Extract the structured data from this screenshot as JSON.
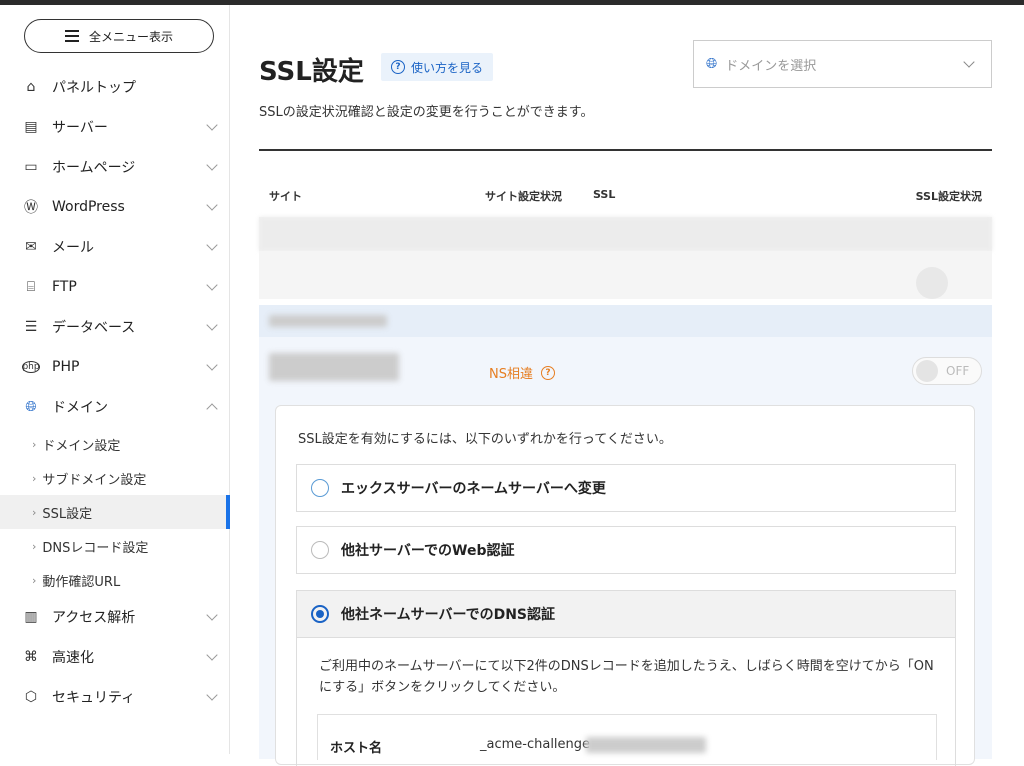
{
  "sidebar": {
    "menu_button": "全メニュー表示",
    "items": [
      {
        "label": "パネルトップ",
        "icon": "home-icon"
      },
      {
        "label": "サーバー",
        "icon": "server-icon"
      },
      {
        "label": "ホームページ",
        "icon": "window-icon"
      },
      {
        "label": "WordPress",
        "icon": "wordpress-icon"
      },
      {
        "label": "メール",
        "icon": "mail-icon"
      },
      {
        "label": "FTP",
        "icon": "ftp-icon"
      },
      {
        "label": "データベース",
        "icon": "database-icon"
      },
      {
        "label": "PHP",
        "icon": "php-icon"
      },
      {
        "label": "ドメイン",
        "icon": "globe-icon"
      }
    ],
    "domain_sub": [
      "ドメイン設定",
      "サブドメイン設定",
      "SSL設定",
      "DNSレコード設定",
      "動作確認URL"
    ],
    "items_after": [
      {
        "label": "アクセス解析",
        "icon": "chart-icon"
      },
      {
        "label": "高速化",
        "icon": "speed-icon"
      },
      {
        "label": "セキュリティ",
        "icon": "shield-icon"
      }
    ]
  },
  "header": {
    "title": "SSL設定",
    "howto": "使い方を見る",
    "domain_placeholder": "ドメインを選択",
    "description": "SSLの設定状況確認と設定の変更を行うことができます。"
  },
  "table": {
    "headers": {
      "site": "サイト",
      "site_status": "サイト設定状況",
      "ssl": "SSL",
      "ssl_status": "SSL設定状況"
    },
    "ns_status": "NS相違",
    "toggle": "OFF"
  },
  "panel": {
    "instruction": "SSL設定を有効にするには、以下のいずれかを行ってください。",
    "options": [
      "エックスサーバーのネームサーバーへ変更",
      "他社サーバーでのWeb認証",
      "他社ネームサーバーでのDNS認証"
    ],
    "dns_text": "ご利用中のネームサーバーにて以下2件のDNSレコードを追加したうえ、しばらく時間を空けてから「ONにする」ボタンをクリックしてください。",
    "host_label": "ホスト名",
    "host_value": "_acme-challenge"
  },
  "colors": {
    "accent": "#1a63c5",
    "warning": "#e67e22",
    "active_bar": "#1a73e8"
  }
}
